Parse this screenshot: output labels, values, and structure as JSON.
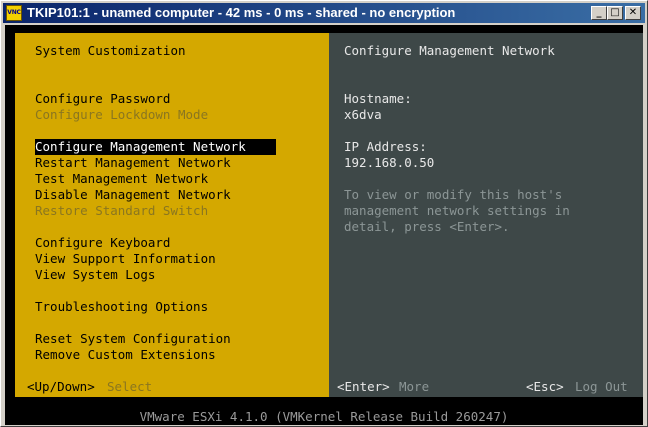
{
  "window": {
    "title": "TKIP101:1 - unamed computer - 42 ms - 0 ms - shared - no encryption",
    "icon_label": "VNC",
    "minimize_glyph": "_",
    "maximize_glyph": "□",
    "close_glyph": "✕"
  },
  "left_pane": {
    "title": "System Customization",
    "menu": [
      {
        "label": "Configure Password",
        "enabled": true
      },
      {
        "label": "Configure Lockdown Mode",
        "enabled": false
      },
      {
        "label": "Configure Management Network",
        "enabled": true,
        "selected": true
      },
      {
        "label": "Restart Management Network",
        "enabled": true
      },
      {
        "label": "Test Management Network",
        "enabled": true
      },
      {
        "label": "Disable Management Network",
        "enabled": true
      },
      {
        "label": "Restore Standard Switch",
        "enabled": false
      },
      {
        "label": "Configure Keyboard",
        "enabled": true
      },
      {
        "label": "View Support Information",
        "enabled": true
      },
      {
        "label": "View System Logs",
        "enabled": true
      },
      {
        "label": "Troubleshooting Options",
        "enabled": true
      },
      {
        "label": "Reset System Configuration",
        "enabled": true
      },
      {
        "label": "Remove Custom Extensions",
        "enabled": true
      }
    ],
    "hint_key": "<Up/Down>",
    "hint_action": "Select"
  },
  "right_pane": {
    "title": "Configure Management Network",
    "hostname_label": "Hostname:",
    "hostname_value": "x6dva",
    "ip_label": "IP Address:",
    "ip_value": "192.168.0.50",
    "help_lines": [
      "To view or modify this host's",
      "management network settings in",
      "detail, press <Enter>."
    ],
    "enter_key": "<Enter>",
    "enter_action": "More",
    "esc_key": "<Esc>",
    "esc_action": "Log Out"
  },
  "footer": "VMware ESXi 4.1.0 (VMKernel Release Build 260247)",
  "colors": {
    "left_pane_bg": "#d4a800",
    "right_pane_bg": "#3e4848",
    "titlebar_start": "#0a246a",
    "titlebar_end": "#3a6ea5"
  }
}
